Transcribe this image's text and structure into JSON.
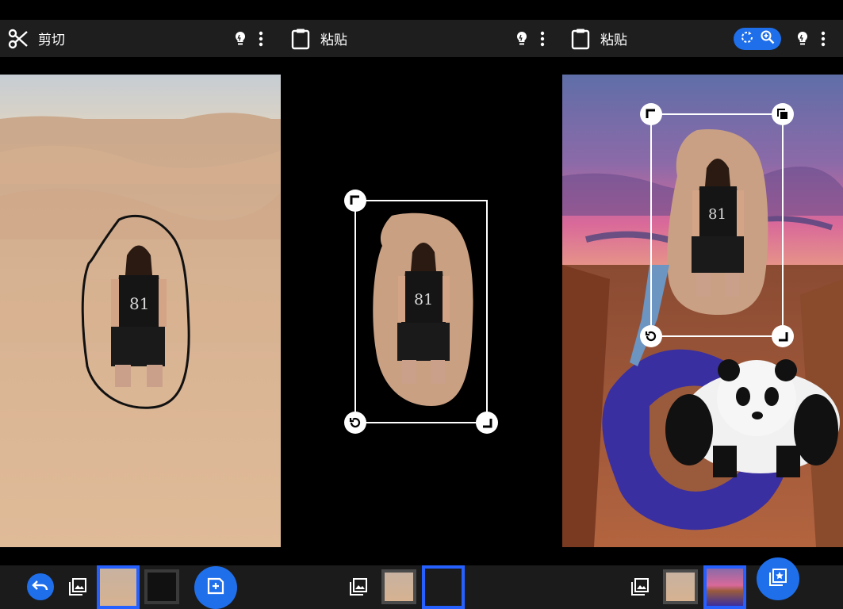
{
  "panels": [
    {
      "title": "剪切",
      "title_icon": "scissors-icon"
    },
    {
      "title": "粘贴",
      "title_icon": "clipboard-icon"
    },
    {
      "title": "粘贴",
      "title_icon": "clipboard-icon"
    }
  ],
  "toolbar_icons": {
    "hint": "lightbulb-icon",
    "more": "more-vert-icon",
    "rotate": "rotate-icon",
    "zoom": "zoom-in-icon"
  },
  "bottom_icons": {
    "undo": "undo-icon",
    "gallery": "image-gallery-icon",
    "add_sticker": "add-sticker-icon",
    "save": "save-star-icon"
  },
  "colors": {
    "accent": "#1f6feb",
    "selection": "#2660ff",
    "toolbar_bg": "#1e1e1e",
    "bottombar_bg": "#1b1b1b"
  }
}
